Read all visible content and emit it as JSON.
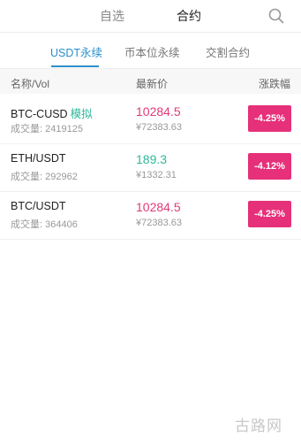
{
  "top_tabs": [
    {
      "label": "自选",
      "active": false
    },
    {
      "label": "合约",
      "active": true
    }
  ],
  "search_icon": "search-icon",
  "sub_tabs": [
    {
      "label": "USDT永续",
      "active": true
    },
    {
      "label": "币本位永续",
      "active": false
    },
    {
      "label": "交割合约",
      "active": false
    }
  ],
  "columns": {
    "name": "名称/Vol",
    "price": "最新价",
    "change": "涨跌幅"
  },
  "rows": [
    {
      "pair": "BTC-CUSD",
      "tag": "模拟",
      "vol": "成交量: 2419125",
      "price": "10284.5",
      "price_color": "red",
      "cny": "¥72383.63",
      "change": "-4.25%"
    },
    {
      "pair": "ETH/USDT",
      "tag": "",
      "vol": "成交量: 292962",
      "price": "189.3",
      "price_color": "green",
      "cny": "¥1332.31",
      "change": "-4.12%"
    },
    {
      "pair": "BTC/USDT",
      "tag": "",
      "vol": "成交量: 364406",
      "price": "10284.5",
      "price_color": "red",
      "cny": "¥72383.63",
      "change": "-4.25%"
    }
  ],
  "watermark": "古路网",
  "colors": {
    "accent": "#2a8fcc",
    "down": "#e6307a",
    "up": "#2fb89c"
  }
}
